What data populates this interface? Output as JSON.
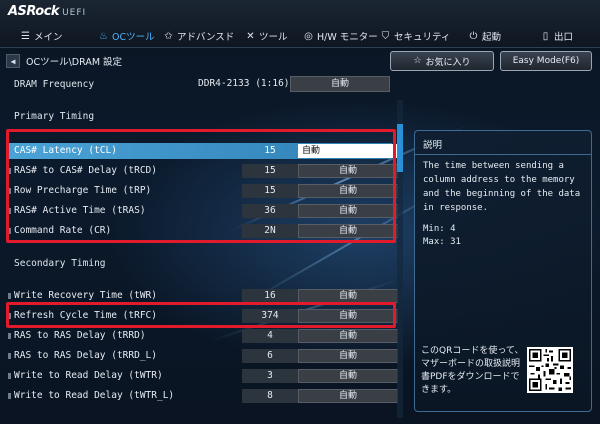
{
  "brand": {
    "logo": "ASRock",
    "suffix": "UEFI"
  },
  "tabs": [
    {
      "label": "メイン",
      "icon": "menu-icon"
    },
    {
      "label": "OCツール",
      "icon": "flame-icon",
      "active": true
    },
    {
      "label": "アドバンスド",
      "icon": "star-icon"
    },
    {
      "label": "ツール",
      "icon": "wrench-icon"
    },
    {
      "label": "H/W モニター",
      "icon": "monitor-icon"
    },
    {
      "label": "セキュリティ",
      "icon": "shield-icon"
    },
    {
      "label": "起動",
      "icon": "power-icon"
    },
    {
      "label": "出口",
      "icon": "exit-icon"
    }
  ],
  "breadcrumb": "OCツール\\DRAM 設定",
  "buttons": {
    "favorites": "お気に入り",
    "easy_mode": "Easy Mode(F6)"
  },
  "dram_frequency": {
    "label": "DRAM Frequency",
    "value": "DDR4-2133 (1:16)",
    "setting": "自動"
  },
  "sections": {
    "primary": "Primary Timing",
    "secondary": "Secondary Timing"
  },
  "primary_rows": [
    {
      "label": "CAS# Latency (tCL)",
      "value": "15",
      "setting": "自動",
      "selected": true
    },
    {
      "label": "RAS# to CAS# Delay (tRCD)",
      "value": "15",
      "setting": "自動"
    },
    {
      "label": "Row Precharge Time (tRP)",
      "value": "15",
      "setting": "自動"
    },
    {
      "label": "RAS# Active Time (tRAS)",
      "value": "36",
      "setting": "自動"
    },
    {
      "label": "Command Rate (CR)",
      "value": "2N",
      "setting": "自動"
    }
  ],
  "secondary_rows": [
    {
      "label": "Write Recovery Time (tWR)",
      "value": "16",
      "setting": "自動"
    },
    {
      "label": "Refresh Cycle Time (tRFC)",
      "value": "374",
      "setting": "自動"
    },
    {
      "label": "RAS to RAS Delay (tRRD)",
      "value": "4",
      "setting": "自動"
    },
    {
      "label": "RAS to RAS Delay (tRRD_L)",
      "value": "6",
      "setting": "自動"
    },
    {
      "label": "Write to Read Delay (tWTR)",
      "value": "3",
      "setting": "自動"
    },
    {
      "label": "Write to Read Delay (tWTR_L)",
      "value": "8",
      "setting": "自動"
    }
  ],
  "description": {
    "title": "説明",
    "body": "The time between sending a\ncolumn address to the memory\nand the beginning of the data\nin response.",
    "min": "Min: 4",
    "max": "Max: 31",
    "qr_text": "このQRコードを使って、マザーボードの取扱説明書PDFをダウンロードできます。"
  },
  "colors": {
    "accent": "#4fb3ff",
    "highlight": "#e11a2c",
    "selection": "#3a95cc"
  }
}
